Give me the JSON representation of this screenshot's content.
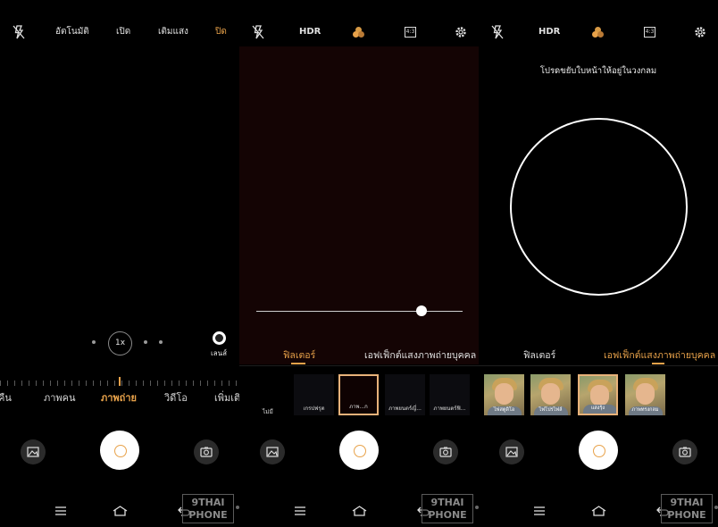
{
  "panel1": {
    "flash_options": [
      "อัตโนมัติ",
      "เปิด",
      "เติมแสง",
      "ปิด"
    ],
    "flash_active": "ปิด",
    "zoom_label": "1x",
    "lens_label": "เลนส์",
    "modes": [
      "คืน",
      "ภาพคน",
      "ภาพถ่าย",
      "วิดีโอ",
      "เพิ่มเติ"
    ],
    "active_mode": "ภาพถ่าย"
  },
  "panel2": {
    "hdr_label": "HDR",
    "ratio_label": "4:3",
    "tabs": [
      "ฟิลเตอร์",
      "เอฟเฟ็กต์แสงภาพถ่ายบุคคล"
    ],
    "active_tab": "ฟิลเตอร์",
    "slider_value": 0.8,
    "none_label": "ไม่มี",
    "filters": [
      "เกรปฟรุต",
      "ภาพ...ก",
      "ภาพยนตร์ญี่...",
      "ภาพยนตร์ฟิ..."
    ]
  },
  "panel3": {
    "hdr_label": "HDR",
    "ratio_label": "4:3",
    "hint": "โปรดขยับใบหน้าให้อยู่ในวงกลม",
    "tabs": [
      "ฟิลเตอร์",
      "เอฟเฟ็กต์แสงภาพถ่ายบุคคล"
    ],
    "active_tab": "เอฟเฟ็กต์แสงภาพถ่ายบุคคล",
    "effects": [
      "ไฟสตูดิโอ",
      "ไฟโปรไฟล์",
      "แสงรุ้ง",
      "ภาพทรงกลม"
    ]
  },
  "watermark": {
    "line1": "9THAI",
    "line2": "PHONE"
  },
  "colors": {
    "accent": "#e8a24a",
    "background": "#000000",
    "viewfinder_tint": "#140404"
  }
}
